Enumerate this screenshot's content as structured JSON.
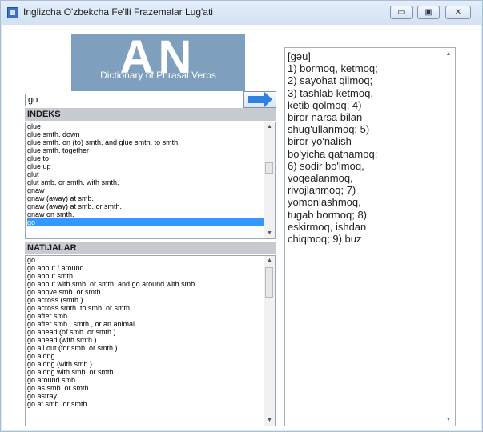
{
  "window": {
    "title": "Inglizcha O'zbekcha Fe'lli Frazemalar Lug'ati",
    "controls": {
      "minimize": "▭",
      "maximize": "▣",
      "close": "✕"
    }
  },
  "logo": {
    "letters": "AN",
    "subtitle": "Dictionary of Phrasal Verbs"
  },
  "search": {
    "value": "go"
  },
  "index": {
    "header": "INDEKS",
    "items": [
      "glue",
      "glue smth. down",
      "glue smth. on (to)  smth. and glue smth. to smth.",
      "glue smth. together",
      "glue to",
      "glue up",
      "glut",
      "glut smb.  or smth. with smth.",
      "gnaw",
      "gnaw  (away)  at smb.",
      "gnaw  (away)  at smb.  or smth.",
      "gnaw on smth.",
      "go"
    ],
    "selected": "go"
  },
  "results": {
    "header": "NATIJALAR",
    "items": [
      "go",
      "go about / around",
      "go about smth.",
      "go about with smb.  or smth. and go around with smb.",
      "go above smb.  or smth.",
      "go across  (smth.)",
      "go across smth. to smb.  or smth.",
      "go after smb.",
      "go after smb.,   smth.,   or an animal",
      "go ahead  (of smb.  or smth.)",
      "go ahead  (with smth.)",
      "go all out  (for smb.  or smth.)",
      "go along",
      "go along  (with smb.)",
      "go along with smb.  or smth.",
      "go around smb.",
      "go as smb.  or smth.",
      "go astray",
      "go at smb.  or smth."
    ]
  },
  "definition": {
    "lines": [
      "[gəu]",
      "1) bormoq, ketmoq;",
      "2) sayohat qilmoq;",
      "3) tashlab ketmoq,",
      "ketib qolmoq; 4)",
      "biror narsa bilan",
      "shug'ullanmoq; 5)",
      "biror yo'nalish",
      "bo'yicha qatnamoq;",
      "6) sodir bo'lmoq,",
      "voqealanmoq,",
      "rivojlanmoq; 7)",
      "yomonlashmoq,",
      "tugab bormoq; 8)",
      "eskirmoq, ishdan",
      "chiqmoq; 9) buz"
    ]
  }
}
